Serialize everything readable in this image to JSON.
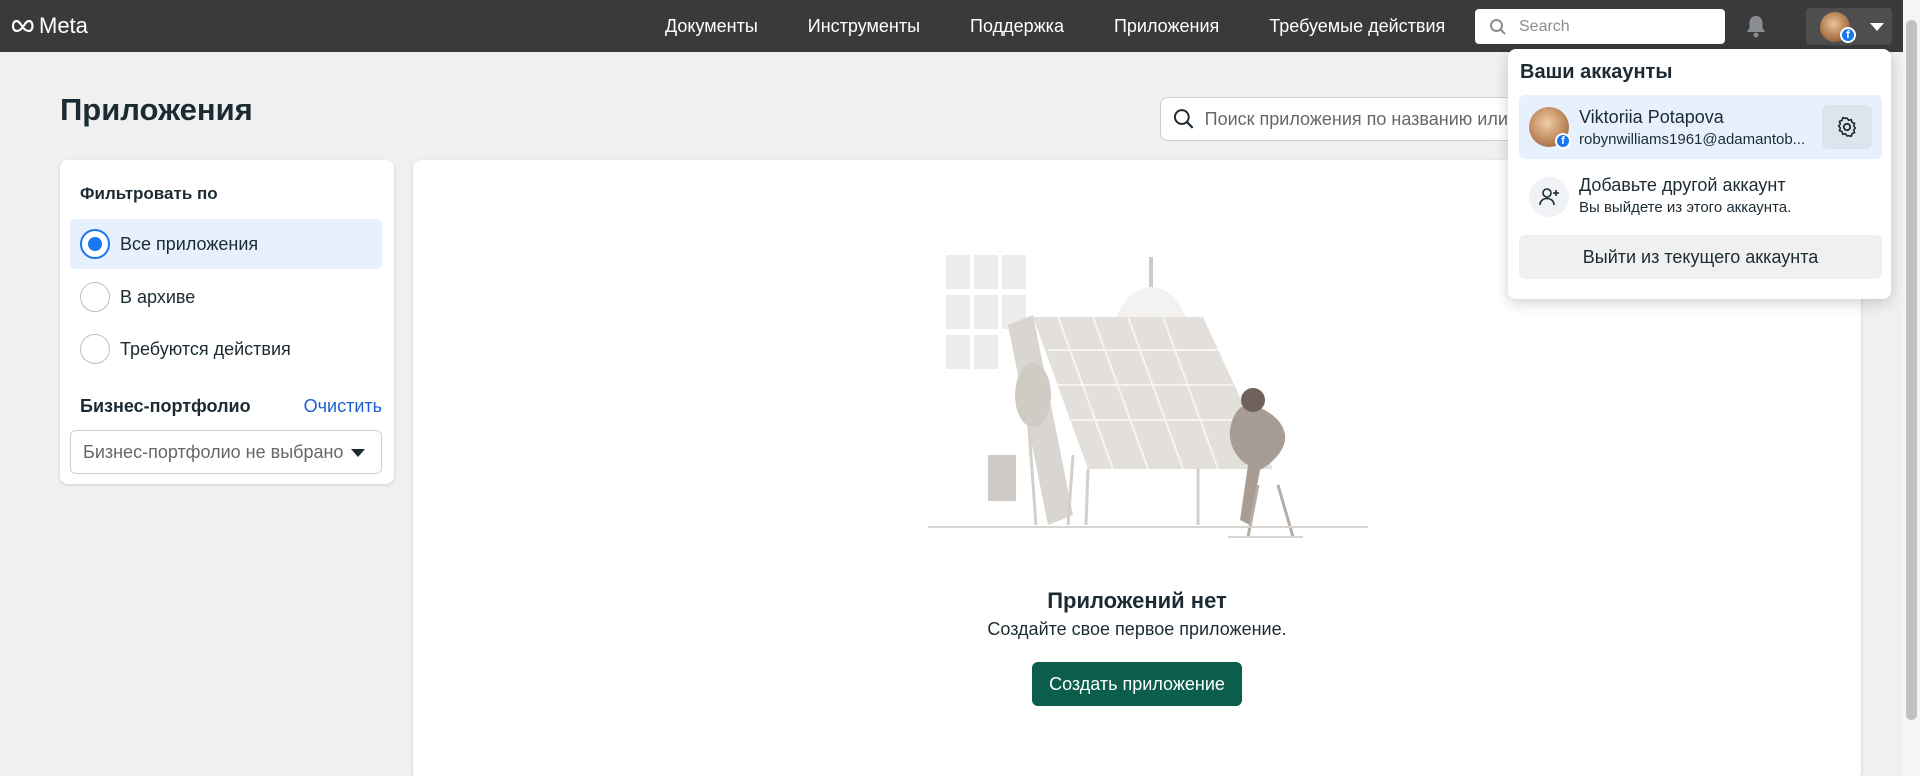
{
  "topbar": {
    "logo_text": "Meta",
    "nav": [
      "Документы",
      "Инструменты",
      "Поддержка",
      "Приложения",
      "Требуемые действия"
    ],
    "search_placeholder": "Search"
  },
  "page": {
    "title": "Приложения",
    "search_placeholder": "Поиск приложения по названию или ID"
  },
  "filter": {
    "heading": "Фильтровать по",
    "options": [
      {
        "label": "Все приложения",
        "selected": true
      },
      {
        "label": "В архиве",
        "selected": false
      },
      {
        "label": "Требуются действия",
        "selected": false
      }
    ],
    "portfolio_heading": "Бизнес-портфолио",
    "clear_label": "Очистить",
    "portfolio_select_value": "Бизнес-портфолио не выбрано"
  },
  "empty_state": {
    "title": "Приложений нет",
    "subtitle": "Создайте свое первое приложение.",
    "button": "Создать приложение"
  },
  "accounts_menu": {
    "heading": "Ваши аккаунты",
    "account_name": "Viktoriia Potapova",
    "account_email": "robynwilliams1961@adamantob...",
    "add_title": "Добавьте другой аккаунт",
    "add_subtitle": "Вы выйдете из этого аккаунта.",
    "logout": "Выйти из текущего аккаунта"
  },
  "colors": {
    "topbar": "#3a3a3a",
    "primary_button": "#0b5e4b",
    "accent_blue": "#1877f2",
    "selected_bg": "#e7f0fd"
  }
}
